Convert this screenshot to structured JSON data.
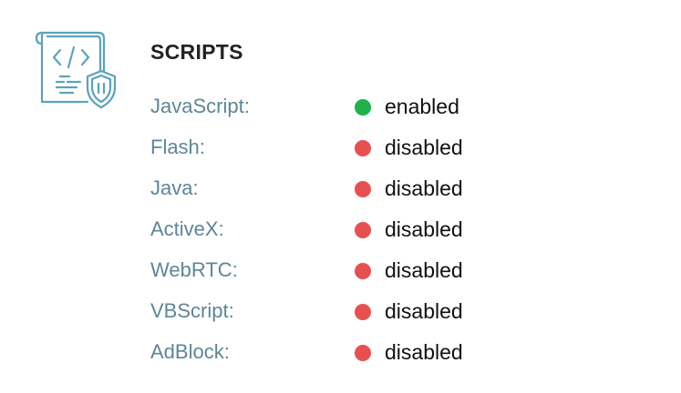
{
  "section": {
    "title": "SCRIPTS",
    "icon": "script-shield-icon"
  },
  "colors": {
    "enabled": "#1fb14a",
    "disabled": "#e8504f",
    "label": "#5e8597",
    "icon_stroke": "#5aa3bd"
  },
  "rows": [
    {
      "label": "JavaScript:",
      "status": "enabled"
    },
    {
      "label": "Flash:",
      "status": "disabled"
    },
    {
      "label": "Java:",
      "status": "disabled"
    },
    {
      "label": "ActiveX:",
      "status": "disabled"
    },
    {
      "label": "WebRTC:",
      "status": "disabled"
    },
    {
      "label": "VBScript:",
      "status": "disabled"
    },
    {
      "label": "AdBlock:",
      "status": "disabled"
    }
  ]
}
